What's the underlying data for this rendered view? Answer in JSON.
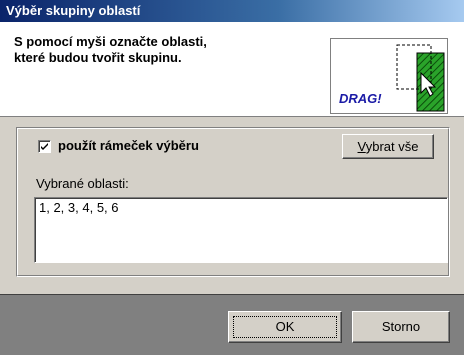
{
  "dialog": {
    "title": "Výběr skupiny oblastí",
    "instruction_line1": "S pomocí myši označte oblasti,",
    "instruction_line2": "které budou tvořit skupinu.",
    "drag_image": {
      "text": "DRAG!",
      "icon": "drag-select-illustration-icon"
    }
  },
  "selection": {
    "use_frame_checked": true,
    "use_frame_label": "použít rámeček výběru",
    "select_all_label": "Vybrat vše",
    "select_all_accesskey": "V"
  },
  "areas": {
    "label": "Vybrané oblasti:",
    "value": "1, 2, 3, 4, 5, 6"
  },
  "buttons": {
    "ok_label": "OK",
    "cancel_label": "Storno"
  },
  "colors": {
    "titlebar_start": "#0a246a",
    "titlebar_end": "#a6caf0",
    "drag_text": "#1a1aa6",
    "hatch_green": "#1e8a1e"
  }
}
